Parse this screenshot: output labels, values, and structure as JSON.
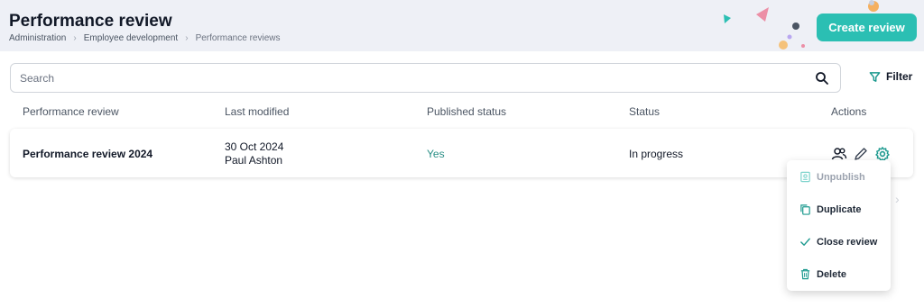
{
  "header": {
    "title": "Performance review",
    "breadcrumb": [
      "Administration",
      "Employee development",
      "Performance reviews"
    ],
    "create_label": "Create review"
  },
  "search": {
    "placeholder": "Search"
  },
  "filter_label": "Filter",
  "table": {
    "columns": [
      "Performance review",
      "Last modified",
      "Published status",
      "Status",
      "Actions"
    ],
    "rows": [
      {
        "name": "Performance review 2024",
        "modified_date": "30 Oct 2024",
        "modified_by": "Paul Ashton",
        "published": "Yes",
        "status": "In progress",
        "actions": [
          "people-icon",
          "pencil-icon",
          "gear-icon"
        ]
      }
    ]
  },
  "context_menu": {
    "items": [
      {
        "label": "Unpublish",
        "icon": "unpublish-icon",
        "disabled": true
      },
      {
        "label": "Duplicate",
        "icon": "copy-icon",
        "disabled": false
      },
      {
        "label": "Close review",
        "icon": "check-icon",
        "disabled": false
      },
      {
        "label": "Delete",
        "icon": "trash-icon",
        "disabled": false
      }
    ]
  },
  "colors": {
    "accent": "#2bbfb3",
    "accent_dark": "#2a8f86",
    "header_bg": "#eef0f6"
  }
}
